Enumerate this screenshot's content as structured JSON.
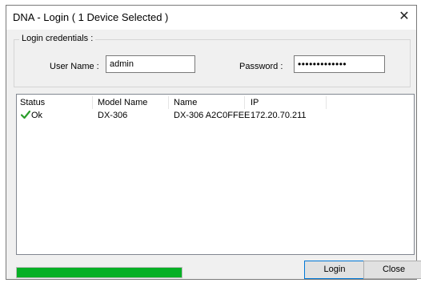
{
  "window": {
    "title": "DNA - Login ( 1 Device Selected )",
    "close_glyph": "✕"
  },
  "credentials": {
    "legend": "Login credentials :",
    "username_label": "User Name :",
    "username_value": "admin",
    "password_label": "Password :",
    "password_mask": "•••••••••••••"
  },
  "devices": {
    "columns": [
      "Status",
      "Model Name",
      "Name",
      "IP"
    ],
    "rows": [
      {
        "status": "Ok",
        "status_icon": "check-icon",
        "model": "DX-306",
        "name": "DX-306 A2C0FFEE",
        "ip": "172.20.70.211"
      }
    ]
  },
  "progress": {
    "value": 1.0,
    "color": "#06b025"
  },
  "buttons": {
    "login_label": "Login",
    "close_label": "Close"
  },
  "colors": {
    "accent": "#0078d7",
    "check": "#2a9d2a"
  }
}
